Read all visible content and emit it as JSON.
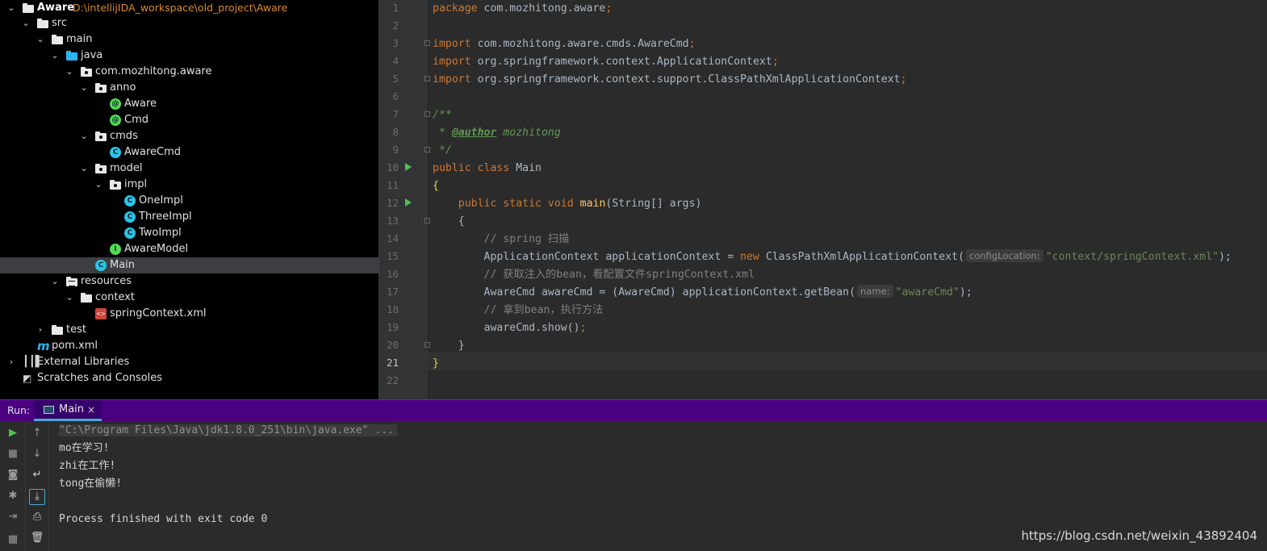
{
  "project_tree": {
    "root": {
      "name": "Aware",
      "path": "D:\\intellijIDA_workspace\\old_project\\Aware"
    },
    "items": [
      {
        "label": "src"
      },
      {
        "label": "main"
      },
      {
        "label": "java"
      },
      {
        "label": "com.mozhitong.aware"
      },
      {
        "label": "anno"
      },
      {
        "label": "Aware",
        "kind": "annotation",
        "badge": "@"
      },
      {
        "label": "Cmd",
        "kind": "annotation",
        "badge": "@"
      },
      {
        "label": "cmds"
      },
      {
        "label": "AwareCmd",
        "kind": "class",
        "badge": "C"
      },
      {
        "label": "model"
      },
      {
        "label": "impl"
      },
      {
        "label": "OneImpl",
        "kind": "class",
        "badge": "C"
      },
      {
        "label": "ThreeImpl",
        "kind": "class",
        "badge": "C"
      },
      {
        "label": "TwoImpl",
        "kind": "class",
        "badge": "C"
      },
      {
        "label": "AwareModel",
        "kind": "interface",
        "badge": "I"
      },
      {
        "label": "Main",
        "kind": "class",
        "badge": "C",
        "selected": true
      },
      {
        "label": "resources"
      },
      {
        "label": "context"
      },
      {
        "label": "springContext.xml",
        "kind": "xml",
        "badge": "<>"
      },
      {
        "label": "test"
      },
      {
        "label": "pom.xml",
        "kind": "maven",
        "badge": "m"
      },
      {
        "label": "External Libraries"
      },
      {
        "label": "Scratches and Consoles"
      }
    ]
  },
  "editor": {
    "line_numbers": [
      "1",
      "2",
      "3",
      "4",
      "5",
      "6",
      "7",
      "8",
      "9",
      "10",
      "11",
      "12",
      "13",
      "14",
      "15",
      "16",
      "17",
      "18",
      "19",
      "20",
      "21",
      "22"
    ],
    "current_line": "21",
    "code": {
      "l1_kw": "package",
      "l1_rest": " com.mozhitong.aware",
      "semi": ";",
      "l3_kw": "import",
      "l3_rest": " com.mozhitong.aware.cmds.AwareCmd",
      "l4_kw": "import",
      "l4_rest": " org.springframework.context.ApplicationContext",
      "l5_kw": "import",
      "l5_rest": " org.springframework.context.support.ClassPathXmlApplicationContext",
      "l7": "/**",
      "l8_star": " * ",
      "l8_tag": "@author",
      "l8_rest": " mozhitong",
      "l9": " */",
      "l10_kw": "public class",
      "l10_name": " Main",
      "l11": "{",
      "l12_indent": "    ",
      "l12_kw": "public static void",
      "l12_sp": " ",
      "l12_fn": "main",
      "l12_rest": "(String[] args)",
      "l13": "    {",
      "l14": "        // spring 扫描",
      "l15_a": "        ApplicationContext applicationContext = ",
      "l15_new": "new",
      "l15_b": " ClassPathXmlApplicationContext(",
      "l15_hint": "configLocation:",
      "l15_str": "\"context/springContext.xml\"",
      "l15_c": ");",
      "l16": "        // 获取注入的bean，看配置文件springContext.xml",
      "l17_a": "        AwareCmd awareCmd = (AwareCmd) applicationContext.getBean(",
      "l17_hint": "name:",
      "l17_str": "\"awareCmd\"",
      "l17_c": ");",
      "l18": "        // 拿到bean，执行方法",
      "l19_a": "        awareCmd.show()",
      "l19_semi": ";",
      "l20": "    }",
      "l21": "}"
    }
  },
  "run_panel": {
    "label": "Run:",
    "tab_label": "Main",
    "tab_close": "×",
    "output": [
      "\"C:\\Program Files\\Java\\jdk1.8.0_251\\bin\\java.exe\" ...",
      "mo在学习!",
      "zhi在工作!",
      "tong在偷懒!",
      "",
      "Process finished with exit code 0"
    ]
  },
  "watermark": "https://blog.csdn.net/weixin_43892404"
}
